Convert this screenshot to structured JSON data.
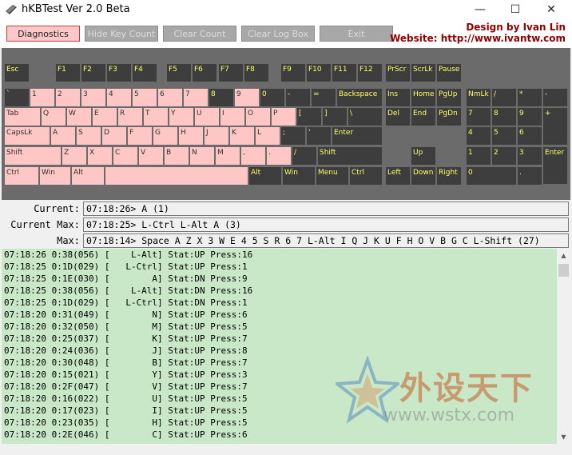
{
  "window": {
    "title": "hKBTest Ver 2.0 Beta",
    "minimize": "—",
    "maximize": "☐",
    "close": "✕"
  },
  "toolbar": {
    "buttons": [
      "Diagnostics",
      "Hide Key Count",
      "Clear Count",
      "Clear Log Box",
      "Exit"
    ],
    "credit_line1": "Design by Ivan Lin",
    "credit_line2": "Website: http://www.ivantw.com"
  },
  "keyboard": {
    "keys": [
      [
        "Esc",
        "up"
      ],
      [
        "F1",
        "up"
      ],
      [
        "F2",
        "up"
      ],
      [
        "F3",
        "up"
      ],
      [
        "F4",
        "up"
      ],
      [
        "F5",
        "up"
      ],
      [
        "F6",
        "up"
      ],
      [
        "F7",
        "up"
      ],
      [
        "F8",
        "up"
      ],
      [
        "F9",
        "up"
      ],
      [
        "F10",
        "up"
      ],
      [
        "F11",
        "up"
      ],
      [
        "F12",
        "up"
      ],
      [
        "PrScr",
        "up"
      ],
      [
        "ScrLk",
        "up"
      ],
      [
        "Pause",
        "up"
      ],
      [
        "`",
        "up"
      ],
      [
        "1",
        "dn"
      ],
      [
        "2",
        "dn"
      ],
      [
        "3",
        "dn"
      ],
      [
        "4",
        "dn"
      ],
      [
        "5",
        "dn"
      ],
      [
        "6",
        "dn"
      ],
      [
        "7",
        "dn"
      ],
      [
        "8",
        "up"
      ],
      [
        "9",
        "dn"
      ],
      [
        "0",
        "up"
      ],
      [
        "-",
        "up"
      ],
      [
        "=",
        "up"
      ],
      [
        "Backspace",
        "up"
      ],
      [
        "Ins",
        "up"
      ],
      [
        "Home",
        "up"
      ],
      [
        "PgUp",
        "up"
      ],
      [
        "NmLk",
        "up"
      ],
      [
        "/",
        "up"
      ],
      [
        "*",
        "up"
      ],
      [
        "-",
        "up"
      ],
      [
        "Tab",
        "dn"
      ],
      [
        "Q",
        "dn"
      ],
      [
        "W",
        "dn"
      ],
      [
        "E",
        "dn"
      ],
      [
        "R",
        "dn"
      ],
      [
        "T",
        "dn"
      ],
      [
        "Y",
        "dn"
      ],
      [
        "U",
        "dn"
      ],
      [
        "I",
        "dn"
      ],
      [
        "O",
        "dn"
      ],
      [
        "P",
        "dn"
      ],
      [
        "[",
        "up"
      ],
      [
        "]",
        "up"
      ],
      [
        "\\",
        "up"
      ],
      [
        "Del",
        "up"
      ],
      [
        "End",
        "up"
      ],
      [
        "PgDn",
        "up"
      ],
      [
        "7",
        "up"
      ],
      [
        "8",
        "up"
      ],
      [
        "9",
        "up"
      ],
      [
        "+",
        "up"
      ],
      [
        "CapsLk",
        "dn"
      ],
      [
        "A",
        "dn"
      ],
      [
        "S",
        "dn"
      ],
      [
        "D",
        "dn"
      ],
      [
        "F",
        "dn"
      ],
      [
        "G",
        "dn"
      ],
      [
        "H",
        "dn"
      ],
      [
        "J",
        "dn"
      ],
      [
        "K",
        "dn"
      ],
      [
        "L",
        "dn"
      ],
      [
        ";",
        "up"
      ],
      [
        "'",
        "up"
      ],
      [
        "Enter",
        "up"
      ],
      [
        "4",
        "up"
      ],
      [
        "5",
        "up"
      ],
      [
        "6",
        "up"
      ],
      [
        "Shift",
        "dn"
      ],
      [
        "Z",
        "dn"
      ],
      [
        "X",
        "dn"
      ],
      [
        "C",
        "dn"
      ],
      [
        "V",
        "dn"
      ],
      [
        "B",
        "dn"
      ],
      [
        "N",
        "dn"
      ],
      [
        "M",
        "dn"
      ],
      [
        ",",
        "dn"
      ],
      [
        ".",
        "dn"
      ],
      [
        "/",
        "up"
      ],
      [
        "Shift",
        "up"
      ],
      [
        "Up",
        "up"
      ],
      [
        "1",
        "up"
      ],
      [
        "2",
        "up"
      ],
      [
        "3",
        "up"
      ],
      [
        "Enter",
        "up"
      ],
      [
        "Ctrl",
        "dn"
      ],
      [
        "Win",
        "dn"
      ],
      [
        "Alt",
        "dn"
      ],
      [
        "",
        "dn"
      ],
      [
        "Alt",
        "up"
      ],
      [
        "Win",
        "up"
      ],
      [
        "Menu",
        "up"
      ],
      [
        "Ctrl",
        "up"
      ],
      [
        "Left",
        "up"
      ],
      [
        "Down",
        "up"
      ],
      [
        "Right",
        "up"
      ],
      [
        "0",
        "up"
      ],
      [
        ".",
        "up"
      ]
    ]
  },
  "info": {
    "current_label": "Current:",
    "current_value": "07:18:26> A (1)",
    "current_max_label": "Current Max:",
    "current_max_value": "07:18:25> L-Ctrl L-Alt A (3)",
    "max_label": "Max:",
    "max_value": "07:18:14> Space A Z X 3 W E 4 5 S R 6 7 L-Alt I Q J K U F H O V B G C L-Shift (27)"
  },
  "log": [
    "07:18:26 0:38(056) [    L-Alt] Stat:UP Press:16",
    "07:18:25 0:1D(029) [   L-Ctrl] Stat:UP Press:1",
    "07:18:25 0:1E(030) [        A] Stat:DN Press:9",
    "07:18:25 0:38(056) [    L-Alt] Stat:DN Press:16",
    "07:18:25 0:1D(029) [   L-Ctrl] Stat:DN Press:1",
    "07:18:20 0:31(049) [        N] Stat:UP Press:6",
    "07:18:20 0:32(050) [        M] Stat:UP Press:5",
    "07:18:20 0:25(037) [        K] Stat:UP Press:7",
    "07:18:20 0:24(036) [        J] Stat:UP Press:8",
    "07:18:20 0:30(048) [        B] Stat:UP Press:7",
    "07:18:20 0:15(021) [        Y] Stat:UP Press:3",
    "07:18:20 0:2F(047) [        V] Stat:UP Press:7",
    "07:18:20 0:16(022) [        U] Stat:UP Press:5",
    "07:18:20 0:17(023) [        I] Stat:UP Press:5",
    "07:18:20 0:23(035) [        H] Stat:UP Press:5",
    "07:18:20 0:2E(046) [        C] Stat:UP Press:6"
  ],
  "watermark": {
    "cn": "外设天下",
    "url": "www.wstx.com"
  },
  "colors": {
    "key_up_bg": "#3d3d3d",
    "key_up_text": "#ffff66",
    "key_dn_bg": "#ffc6c6",
    "log_bg": "#c8e8c8",
    "credit": "#900000"
  }
}
